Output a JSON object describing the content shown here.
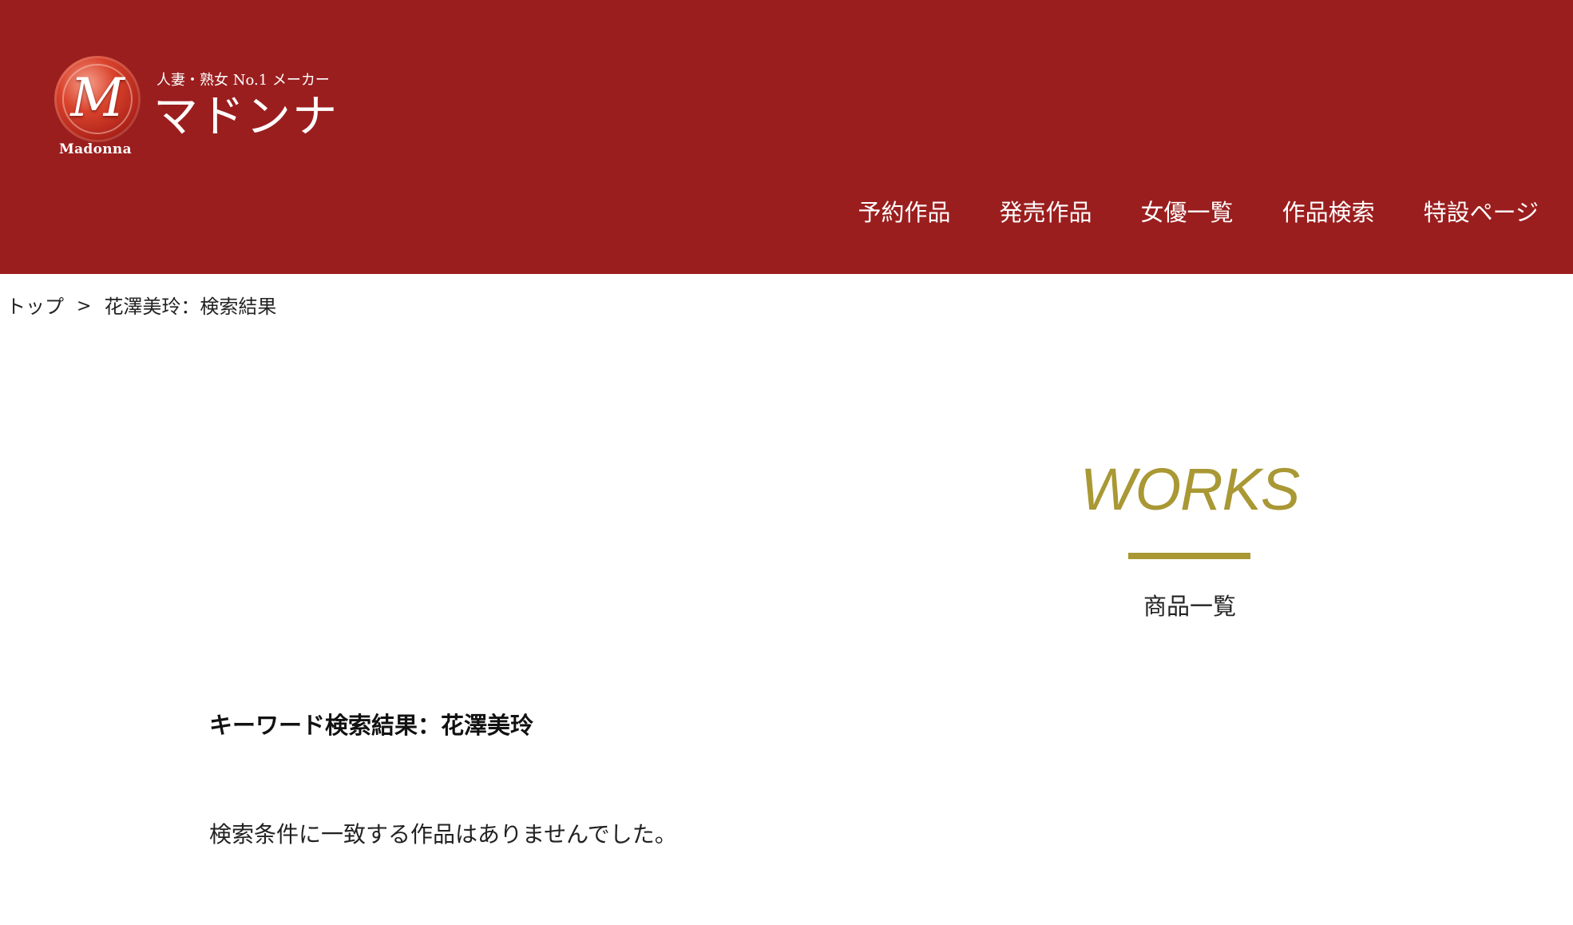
{
  "brand": {
    "emblem_letter": "M",
    "emblem_caption": "Madonna",
    "tagline": "人妻・熟女 No.1 メーカー",
    "name": "マドンナ"
  },
  "nav": {
    "items": [
      {
        "label": "予約作品"
      },
      {
        "label": "発売作品"
      },
      {
        "label": "女優一覧"
      },
      {
        "label": "作品検索"
      },
      {
        "label": "特設ページ"
      }
    ]
  },
  "breadcrumb": {
    "home": "トップ",
    "separator": ">",
    "current": "花澤美玲：検索結果"
  },
  "section": {
    "title": "WORKS",
    "subtitle": "商品一覧"
  },
  "search": {
    "heading": "キーワード検索結果：花澤美玲",
    "empty_message": "検索条件に一致する作品はありませんでした。"
  },
  "colors": {
    "header_bg": "#9b1e1e",
    "accent_gold": "#a99834",
    "text": "#222222"
  }
}
